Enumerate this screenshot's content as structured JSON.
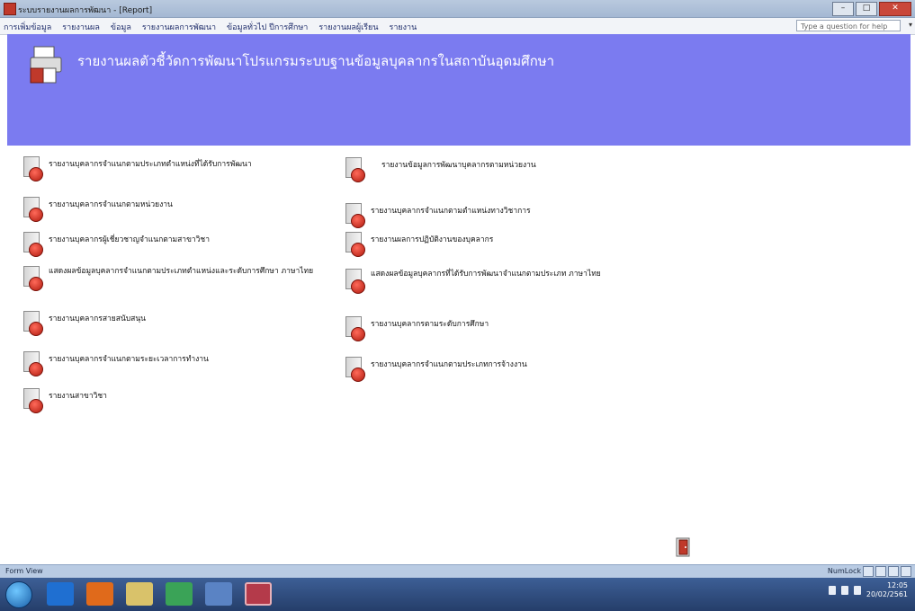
{
  "window": {
    "title": "ระบบรายงานผลการพัฒนา - [Report]",
    "controls": [
      "–",
      "□",
      "✕"
    ]
  },
  "menubar": {
    "items": [
      "การเพิ่มข้อมูล",
      "รายงานผล",
      "ข้อมูล",
      "รายงานผลการพัฒนา",
      "ข้อมูลทั่วไป ปีการศึกษา",
      "รายงานผลผู้เรียน",
      "รายงาน"
    ],
    "help_placeholder": "Type a question for help"
  },
  "header": {
    "title": "รายงานผลตัวชี้วัดการพัฒนาโปรแกรมระบบฐานข้อมูลบุคลากรในสถาบันอุดมศึกษา"
  },
  "reports": {
    "left": [
      "รายงานบุคลากรจำแนกตามประเภทตำแหน่งที่ได้รับการพัฒนา",
      "รายงานบุคลากรจำแนกตามหน่วยงาน",
      "รายงานบุคลากรผู้เชี่ยวชาญจำแนกตามสาขาวิชา",
      "แสดงผลข้อมูลบุคลากรจำแนกตามประเภทตำแหน่งและระดับการศึกษา ภาษาไทย",
      "รายงานบุคลากรสายสนับสนุน",
      "รายงานบุคลากรจำแนกตามระยะเวลาการทำงาน",
      "รายงานสาขาวิชา"
    ],
    "right": [
      "รายงานข้อมูลการพัฒนาบุคลากรตามหน่วยงาน",
      "รายงานบุคลากรจำแนกตามตำแหน่งทางวิชาการ",
      "รายงานผลการปฏิบัติงานของบุคลากร",
      "แสดงผลข้อมูลบุคลากรที่ได้รับการพัฒนาจำแนกตามประเภท ภาษาไทย",
      "รายงานบุคลากรตามระดับการศึกษา",
      "รายงานบุคลากรจำแนกตามประเภทการจ้างงาน"
    ]
  },
  "statusbar": {
    "left": "Form View",
    "right": "NumLock"
  },
  "clock": {
    "time": "12:05",
    "date": "20/02/2561"
  }
}
